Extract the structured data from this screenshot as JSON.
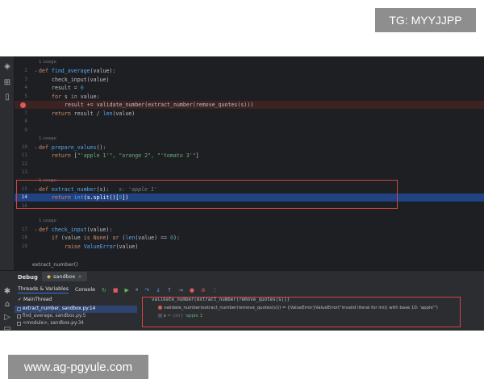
{
  "watermarks": {
    "top": "TG: MYYJJPP",
    "bottom": "www.ag-pgyule.com"
  },
  "colors": {
    "editor_bg": "#1e1f22",
    "selection": "#214283",
    "breakpoint": "#db5c5c",
    "annotation": "#d24545"
  },
  "left_strip_icons": [
    "project-icon",
    "structure-icon",
    "bookmark-icon"
  ],
  "editor": {
    "usage_1": "1 usage",
    "usage_2": "1 usage",
    "usage_3": "1 usage",
    "usage_4": "1 usage",
    "lines": {
      "l1": {
        "no": "1",
        "text": ""
      },
      "l2": {
        "no": "2"
      },
      "l3": {
        "no": "3",
        "text": "check_input(value)"
      },
      "l4": {
        "no": "4"
      },
      "l5": {
        "no": "5"
      },
      "l6": {
        "no": "6"
      },
      "l7": {
        "no": "7"
      },
      "l8": {
        "no": "8"
      },
      "l9": {
        "no": "9"
      },
      "l10": {
        "no": "10"
      },
      "l11": {
        "no": "11"
      },
      "l12": {
        "no": "12"
      },
      "l13": {
        "no": "13"
      },
      "l14": {
        "no": "14"
      },
      "l15": {
        "no": "15"
      },
      "l16": {
        "no": "16"
      },
      "l17": {
        "no": "17"
      },
      "l18": {
        "no": "18"
      },
      "l19": {
        "no": "19"
      }
    },
    "comment_apple": "s: 'apple 1'"
  },
  "breadcrumb": "extract_number()",
  "debug": {
    "title": "Debug",
    "session_tab": "sandbox",
    "threads_tab": "Threads & Variables",
    "console_tab": "Console",
    "thread": "MainThread",
    "frames": [
      "extract_number, sandbox.py:14",
      "find_average, sandbox.py:5",
      "<module>, sandbox.py:34"
    ],
    "var_header": "validate_number(extract_number(remove_quotes(s)))",
    "var_error": "validate_number(extract_number(remove_quotes(s))) = {ValueError}ValueError(\"invalid literal for int() with base 10: 'apple'\")",
    "var_s_name": "s",
    "var_s_type": "= {str}",
    "var_s_val": "'apple 1'"
  }
}
